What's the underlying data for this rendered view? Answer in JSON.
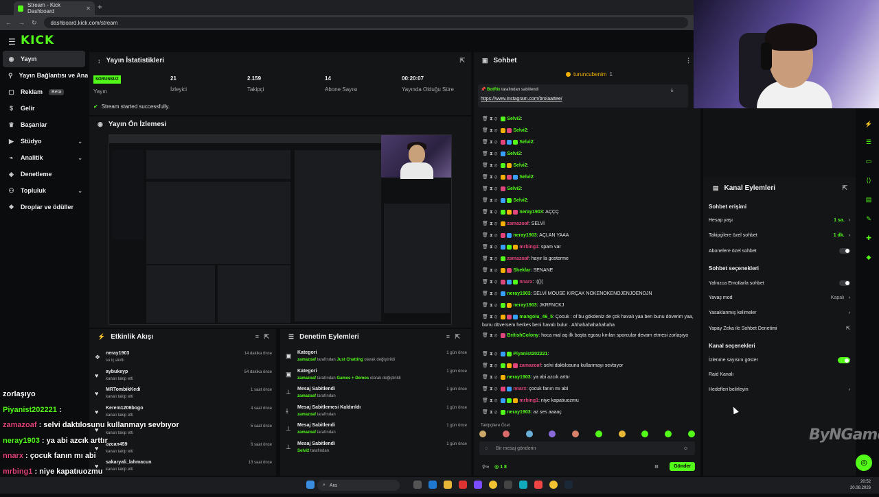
{
  "browser": {
    "tab_title": "Stream - Kick Dashboard",
    "url": "dashboard.kick.com/stream"
  },
  "brand": {
    "logo": "KICK",
    "accent": "#53fc18"
  },
  "sidebar": {
    "items": [
      {
        "label": "Yayın",
        "icon": "broadcast-icon",
        "active": true
      },
      {
        "label": "Yayın Bağlantısı ve Anahtarı",
        "icon": "link-icon"
      },
      {
        "label": "Reklam",
        "icon": "ad-icon",
        "badge": "Beta"
      },
      {
        "label": "Gelir",
        "icon": "money-icon"
      },
      {
        "label": "Başarılar",
        "icon": "trophy-icon"
      },
      {
        "label": "Stüdyo",
        "icon": "studio-icon",
        "expandable": true
      },
      {
        "label": "Analitik",
        "icon": "analytics-icon",
        "expandable": true
      },
      {
        "label": "Denetleme",
        "icon": "shield-icon"
      },
      {
        "label": "Topluluk",
        "icon": "community-icon",
        "expandable": true
      },
      {
        "label": "Droplar ve ödüller",
        "icon": "gift-icon"
      }
    ]
  },
  "stats": {
    "title": "Yayın İstatistikleri",
    "status_badge": "SORUNSUZ",
    "status_label": "Yayın",
    "viewers_value": "21",
    "viewers_label": "İzleyici",
    "followers_value": "2.159",
    "followers_label": "Takipçi",
    "subs_value": "14",
    "subs_label": "Abone Sayısı",
    "uptime_value": "00:20:07",
    "uptime_label": "Yayında Olduğu Süre",
    "message": "Stream started successfully."
  },
  "preview": {
    "title": "Yayın Ön İzlemesi"
  },
  "activity": {
    "title": "Etkinlik Akışı",
    "items": [
      {
        "name": "neray1903",
        "sub": "su iç akıttı",
        "time": "14 dakika önce",
        "icon": "gift-icon"
      },
      {
        "name": "aybukeyp",
        "sub": "kanalı takip etti",
        "time": "54 dakika önce",
        "icon": "heart-icon"
      },
      {
        "name": "MRTombikKedi",
        "sub": "kanalı takip etti",
        "time": "1 saat önce",
        "icon": "heart-icon"
      },
      {
        "name": "Kerem1206bogo",
        "sub": "kanalı takip etti",
        "time": "4 saat önce",
        "icon": "heart-icon"
      },
      {
        "name": "",
        "sub": "kanalı takip etti",
        "time": "5 saat önce",
        "icon": "heart-icon"
      },
      {
        "name": "ozcan459",
        "sub": "kanalı takip etti",
        "time": "6 saat önce",
        "icon": "heart-icon"
      },
      {
        "name": "sakaryali_lahmacun",
        "sub": "kanalı takip etti",
        "time": "13 saat önce",
        "icon": "heart-icon"
      }
    ]
  },
  "moderation": {
    "title": "Denetim Eylemleri",
    "items": [
      {
        "title": "Kategori",
        "actor": "zamazoaf",
        "mid": " tarafından ",
        "target": "Just Chatting",
        "rest": " olarak değiştirildi",
        "time": "1 gün önce",
        "icon": "category-icon"
      },
      {
        "title": "Kategori",
        "actor": "zamazoaf",
        "mid": " tarafından ",
        "target": "Games + Demos",
        "rest": " olarak değiştirildi",
        "time": "1 gün önce",
        "icon": "category-icon"
      },
      {
        "title": "Mesaj Sabitlendi",
        "actor": "zamazoaf",
        "mid": " tarafından",
        "target": "",
        "rest": "",
        "time": "1 gün önce",
        "icon": "pin-icon"
      },
      {
        "title": "Mesaj Sabitlemesi Kaldırıldı",
        "actor": "zamazoaf",
        "mid": " tarafından",
        "target": "",
        "rest": "",
        "time": "1 gün önce",
        "icon": "unpin-icon"
      },
      {
        "title": "Mesaj Sabitlendi",
        "actor": "zamazoaf",
        "mid": " tarafından",
        "target": "",
        "rest": "",
        "time": "1 gün önce",
        "icon": "pin-icon"
      },
      {
        "title": "Mesaj Sabitlendi",
        "actor": "Selvi2",
        "mid": " tarafından",
        "target": "",
        "rest": "",
        "time": "1 gün önce",
        "icon": "pin-icon"
      }
    ]
  },
  "chat": {
    "title": "Sohbet",
    "gifter": "turuncubenim",
    "gifter_count": "1",
    "pinned_by": "BotRix",
    "pinned_suffix": "tarafından sabitlendi",
    "pinned_link": "https://www.instagram.com/brolaattee/",
    "messages": [
      {
        "user": "Selvi2",
        "color": "#53fc18",
        "text": ""
      },
      {
        "user": "Selvi2",
        "color": "#53fc18",
        "text": ""
      },
      {
        "user": "Selvi2",
        "color": "#53fc18",
        "text": ""
      },
      {
        "user": "Selvi2",
        "color": "#53fc18",
        "text": ""
      },
      {
        "user": "Selvi2",
        "color": "#53fc18",
        "text": ""
      },
      {
        "user": "Selvi2",
        "color": "#53fc18",
        "text": ""
      },
      {
        "user": "Selvi2",
        "color": "#53fc18",
        "text": ""
      },
      {
        "user": "Selvi2",
        "color": "#53fc18",
        "text": ""
      },
      {
        "user": "neray1903",
        "color": "#53fc18",
        "text": "AÇÇÇ"
      },
      {
        "user": "zamazoaf",
        "color": "#e0457b",
        "text": "SELVİ"
      },
      {
        "user": "neray1903",
        "color": "#53fc18",
        "text": "AÇLAN YAAA"
      },
      {
        "user": "mrbing1",
        "color": "#e0457b",
        "text": "spam var"
      },
      {
        "user": "zamazoaf",
        "color": "#e0457b",
        "text": "hayır la gosterme"
      },
      {
        "user": "Sheklar",
        "color": "#53fc18",
        "text": "SENANE"
      },
      {
        "user": "nnarx",
        "color": "#e0457b",
        "text": ":(((("
      },
      {
        "user": "neray1903",
        "color": "#53fc18",
        "text": "SELVİ MOUSE KIRÇAK NOKENOKENOJENJOENOJN"
      },
      {
        "user": "neray1903",
        "color": "#53fc18",
        "text": "JKRFNCKJ"
      },
      {
        "user": "mangolu_46_5",
        "color": "#53fc18",
        "text": "Çocuk : of bu gökdeniz de çok havalı yaa ben bunu döverim yaa, bunu döversem herkes beni havalı bulur . Ahhahahahahahaha",
        "wrap": true
      },
      {
        "user": "BritishColony",
        "color": "#53fc18",
        "text": "hoca mal aq ilk başta egosu kırılan sporcular devam etmesi zorlaşıyo",
        "wrap": true
      },
      {
        "user": "Piyanist202221",
        "color": "#53fc18",
        "text": ""
      },
      {
        "user": "zamazoaf",
        "color": "#e0457b",
        "text": "selvi daktılosunu kullanmayı sevbıyor"
      },
      {
        "user": "neray1903",
        "color": "#53fc18",
        "text": "ya abi azcık arttır"
      },
      {
        "user": "nnarx",
        "color": "#e0457b",
        "text": "çocuk fanın mı abi"
      },
      {
        "user": "mrbing1",
        "color": "#e0457b",
        "text": "niye kapatıuozmu"
      },
      {
        "user": "neray1903",
        "color": "#53fc18",
        "text": "az ses aaaaç"
      }
    ],
    "sub_emotes_label": "Takipçilere Özel",
    "input_placeholder": "Bir mesaj gönderin",
    "points": "1 8",
    "send_label": "Gönder"
  },
  "channel_actions": {
    "title": "Kanal Eylemleri",
    "sec1": "Sohbet erişimi",
    "account_age_label": "Hesap yaşı",
    "account_age_value": "1 sa.",
    "followers_only_label": "Takipçilere özel sohbet",
    "followers_only_value": "1 dk.",
    "subs_only_label": "Abonelere özel sohbet",
    "sec2": "Sohbet seçenekleri",
    "emote_only_label": "Yalnızca Emotlarla sohbet",
    "slow_mode_label": "Yavaş mod",
    "slow_mode_value": "Kapalı",
    "banned_words_label": "Yasaklanmış kelimeler",
    "ai_mod_label": "Yapay Zeka ile Sohbet Denetimi",
    "sec3": "Kanal seçenekleri",
    "show_viewers_label": "İzlenme sayısını göster",
    "raid_label": "Raid Kanalı",
    "goals_label": "Hedefleri belirleyin"
  },
  "overlay": {
    "lines": [
      {
        "user": "zorlaşıyo",
        "text": "",
        "color": "#ffffff"
      },
      {
        "user": "Piyanist202221",
        "text": " :",
        "color": "#53fc18"
      },
      {
        "user": "zamazoaf",
        "text": " : selvi daktılosunu kullanmayı sevbıyor",
        "color": "#e0457b"
      },
      {
        "user": "neray1903",
        "text": " : ya abi azcık arttır",
        "color": "#53fc18"
      },
      {
        "user": "nnarx",
        "text": " : çocuk fanın mı abi",
        "color": "#e0457b"
      },
      {
        "user": "mrbing1",
        "text": " : niye kapatıuozmu",
        "color": "#e0457b"
      },
      {
        "user": "neray1903",
        "text": " : az ses aaaaç",
        "color": "#53fc18"
      }
    ]
  },
  "taskbar": {
    "search": "Ara",
    "time": "20:52",
    "date": "20.08.2026"
  },
  "watermark": "ByNGame"
}
